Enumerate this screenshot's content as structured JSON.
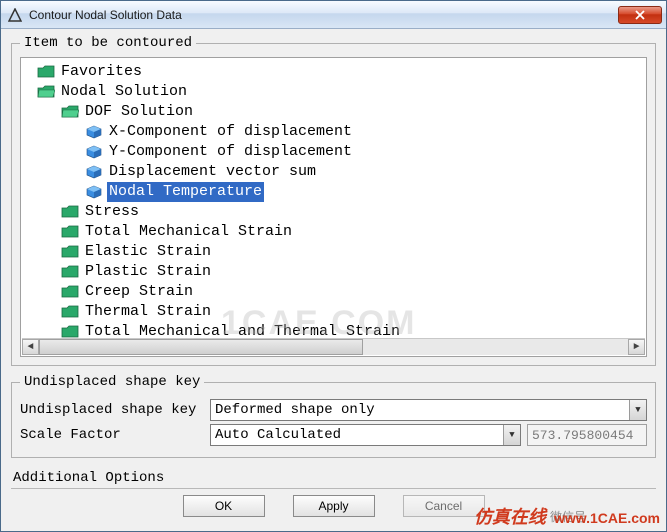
{
  "window": {
    "title": "Contour Nodal Solution Data"
  },
  "group_item": {
    "legend": "Item to be contoured"
  },
  "tree": {
    "items": [
      {
        "label": "Favorites",
        "indent": 0,
        "icon": "folder",
        "selected": false
      },
      {
        "label": "Nodal Solution",
        "indent": 0,
        "icon": "folder-open",
        "selected": false
      },
      {
        "label": "DOF Solution",
        "indent": 1,
        "icon": "folder-open",
        "selected": false
      },
      {
        "label": "X-Component of displacement",
        "indent": 2,
        "icon": "cube",
        "selected": false
      },
      {
        "label": "Y-Component of displacement",
        "indent": 2,
        "icon": "cube",
        "selected": false
      },
      {
        "label": "Displacement vector sum",
        "indent": 2,
        "icon": "cube",
        "selected": false
      },
      {
        "label": "Nodal Temperature",
        "indent": 2,
        "icon": "cube",
        "selected": true
      },
      {
        "label": "Stress",
        "indent": 1,
        "icon": "folder",
        "selected": false
      },
      {
        "label": "Total Mechanical Strain",
        "indent": 1,
        "icon": "folder",
        "selected": false
      },
      {
        "label": "Elastic Strain",
        "indent": 1,
        "icon": "folder",
        "selected": false
      },
      {
        "label": "Plastic Strain",
        "indent": 1,
        "icon": "folder",
        "selected": false
      },
      {
        "label": "Creep Strain",
        "indent": 1,
        "icon": "folder",
        "selected": false
      },
      {
        "label": "Thermal Strain",
        "indent": 1,
        "icon": "folder",
        "selected": false
      },
      {
        "label": "Total Mechanical and Thermal Strain",
        "indent": 1,
        "icon": "folder",
        "selected": false
      }
    ]
  },
  "group_shape": {
    "legend": "Undisplaced shape key",
    "row_shape_label": "Undisplaced shape key",
    "row_shape_value": "Deformed shape only",
    "row_scale_label": "Scale Factor",
    "row_scale_value": "Auto Calculated",
    "row_scale_readonly": "573.795800454"
  },
  "additional": {
    "label": "Additional Options"
  },
  "buttons": {
    "ok": "OK",
    "apply": "Apply",
    "cancel": "Cancel"
  },
  "watermarks": {
    "center": "1CAE.COM",
    "cn": "仿真在线",
    "url": "www.1CAE.com",
    "wx": "微信号"
  }
}
